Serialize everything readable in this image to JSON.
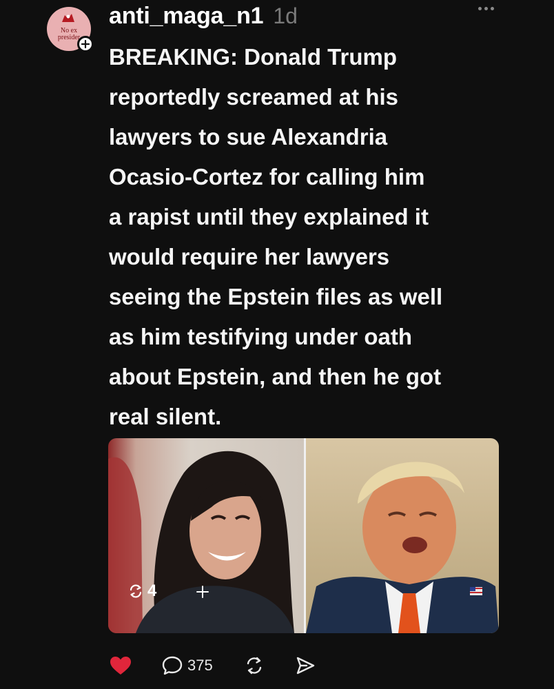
{
  "post": {
    "author": {
      "username": "anti_maga_n1",
      "avatar_label": "No ex presider",
      "follow_icon": "plus-icon"
    },
    "timestamp": "1d",
    "more_icon": "ellipsis-icon",
    "text": "BREAKING: Donald Trump\nreportedly screamed at his\nlawyers to sue Alexandria\nOcasio-Cortez for calling him\na rapist until they explained it\nwould require her lawyers\nseeing the Epstein files as well\nas him testifying under oath\nabout Epstein, and then he got\nreal silent.",
    "media": {
      "repost_count": "4",
      "add_icon": "plus-icon"
    },
    "actions": {
      "like_icon": "heart-icon",
      "like_color": "#e0263b",
      "reply_icon": "speech-bubble-icon",
      "reply_count": "375",
      "repost_icon": "repost-icon",
      "share_icon": "send-icon"
    }
  }
}
